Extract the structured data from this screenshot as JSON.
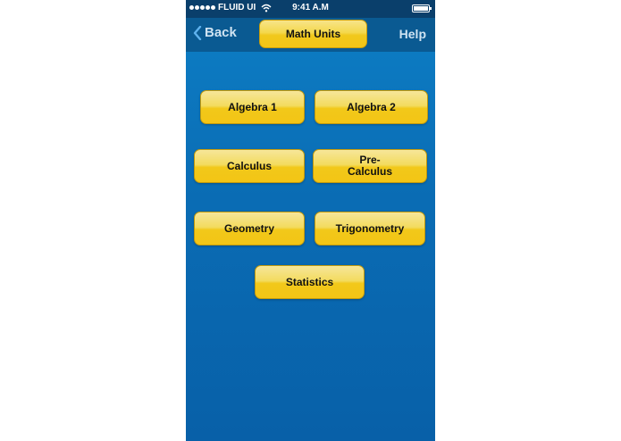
{
  "status": {
    "carrier": "FLUID UI",
    "time": "9:41 A.M"
  },
  "nav": {
    "back_label": "Back",
    "title": "Math Units",
    "help_label": "Help"
  },
  "units": [
    {
      "label": "Algebra 1"
    },
    {
      "label": "Algebra 2"
    },
    {
      "label": "Calculus"
    },
    {
      "label": "Pre-\nCalculus"
    },
    {
      "label": "Geometry"
    },
    {
      "label": "Trigonometry"
    },
    {
      "label": "Statistics"
    }
  ],
  "colors": {
    "background": "#0a6cb4",
    "nav_bar": "#0a5a92",
    "status_bar": "#0a3f6b",
    "button_yellow": "#f2c81a"
  }
}
